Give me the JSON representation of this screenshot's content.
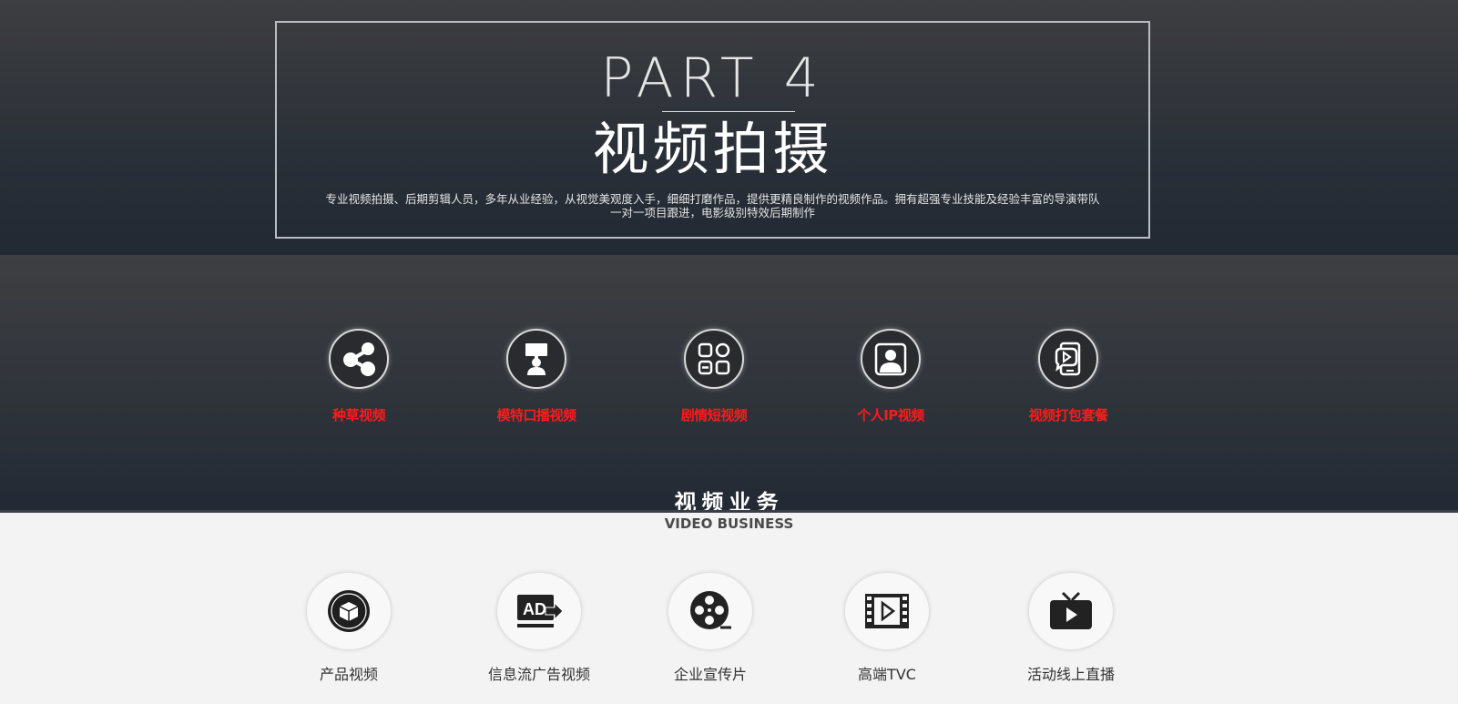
{
  "hero": {
    "part": "PART 4",
    "title": "视频拍摄",
    "desc_line1": "专业视频拍摄、后期剪辑人员，多年从业经验，从视觉美观度入手，细细打磨作品，提供更精良制作的视频作品。拥有超强专业技能及经验丰富的导演带队",
    "desc_line2": "一对一项目跟进，电影级别特效后期制作"
  },
  "services": [
    {
      "label": "种草视频",
      "icon": "share-icon"
    },
    {
      "label": "模特口播视频",
      "icon": "presenter-icon"
    },
    {
      "label": "剧情短视频",
      "icon": "grid-apps-icon"
    },
    {
      "label": "个人IP视频",
      "icon": "person-portrait-icon"
    },
    {
      "label": "视频打包套餐",
      "icon": "mobile-video-icon"
    }
  ],
  "section": {
    "title": "视频业务",
    "subtitle": "VIDEO BUSINESS"
  },
  "business": [
    {
      "label": "产品视频",
      "icon": "box-icon"
    },
    {
      "label": "信息流广告视频",
      "icon": "ad-icon"
    },
    {
      "label": "企业宣传片",
      "icon": "film-reel-icon"
    },
    {
      "label": "高端TVC",
      "icon": "film-strip-play-icon"
    },
    {
      "label": "活动线上直播",
      "icon": "tv-live-icon"
    }
  ],
  "colors": {
    "accent_red": "#ff1a1a",
    "hero_bg": "#2a3038",
    "light_bg": "#f3f3f3"
  }
}
